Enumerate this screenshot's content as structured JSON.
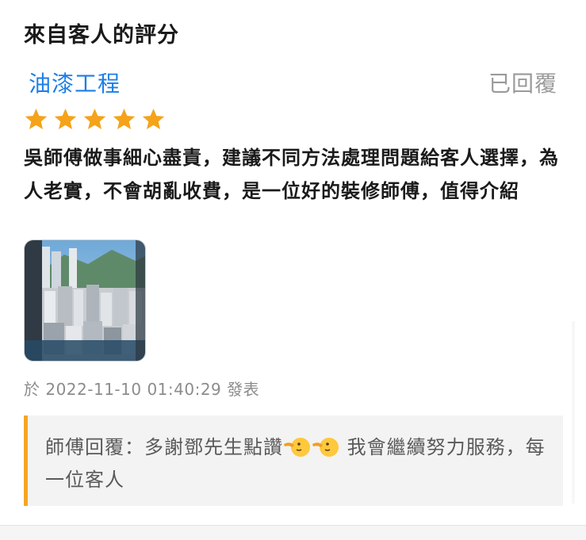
{
  "section": {
    "title": "來自客人的評分"
  },
  "review": {
    "service_name": "油漆工程",
    "reply_status": "已回覆",
    "rating": 5,
    "rating_max": 5,
    "star_color": "#f5a31a",
    "text": "吳師傅做事細心盡責，建議不同方法處理問題給客人選擇，為人老實，不會胡亂收費，是一位好的裝修師傅，值得介紹",
    "photo_icon": "city-view-photo",
    "timestamp": "於 2022-11-10 01:40:29 發表"
  },
  "reply": {
    "text_before": "師傅回覆：多謝鄧先生點讚",
    "emoji": [
      "pointing-face-emoji",
      "pointing-face-emoji"
    ],
    "text_after": " 我會繼續努力服務，每一位客人",
    "accent_color": "#f5a623"
  }
}
